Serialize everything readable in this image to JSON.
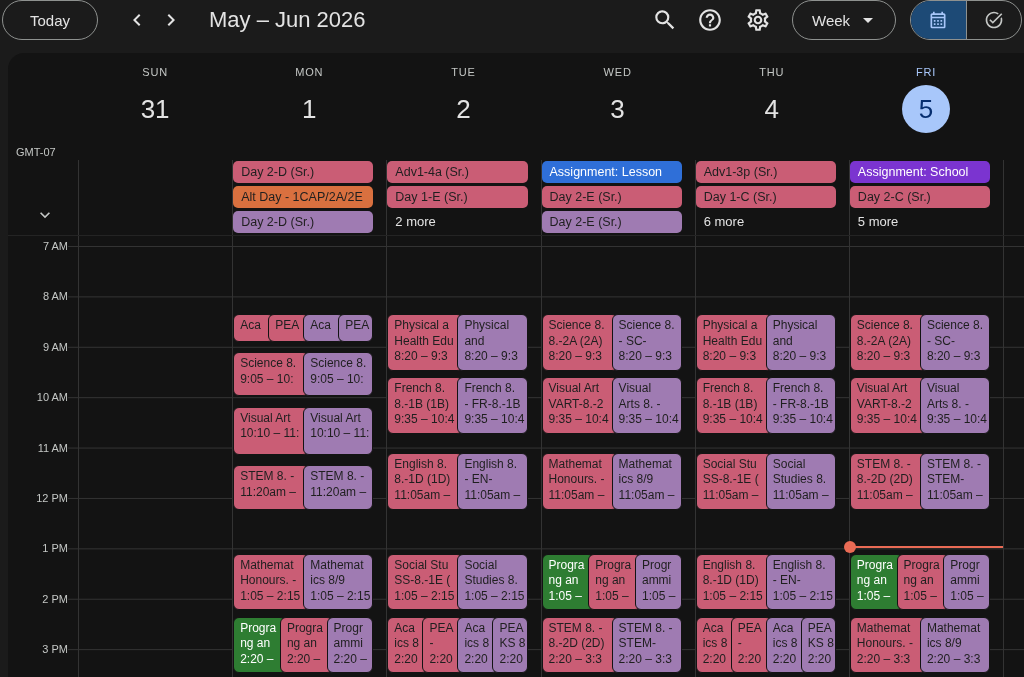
{
  "toolbar": {
    "today_button": "Today",
    "title": "May – Jun 2026",
    "view_dropdown": "Week",
    "view_switch": [
      {
        "kind": "calendar",
        "selected": true
      },
      {
        "kind": "tasks",
        "selected": false
      }
    ]
  },
  "timezone": "GMT-07",
  "days": [
    {
      "name": "SUN",
      "date": "31",
      "today": false
    },
    {
      "name": "MON",
      "date": "1",
      "today": false,
      "all_day": [
        {
          "title": "Day 2-D (Sr.)",
          "color": "#ca5d75"
        },
        {
          "title": "Alt Day - 1CAP/2A/2E",
          "color": "#d9703f"
        },
        {
          "title": "Day 2-D (Sr.)",
          "color": "#9f7bb2"
        }
      ],
      "event_groups": [
        {
          "events": [
            {
              "title": "Aca",
              "color": "#ca5d75"
            },
            {
              "title": "PEA",
              "color": "#ca5d75"
            },
            {
              "title": "Aca",
              "color": "#9f7bb2"
            },
            {
              "title": "PEA",
              "color": "#9f7bb2"
            }
          ]
        },
        {
          "events": [
            {
              "title": "Science 8.",
              "time": "9:05 – 10:",
              "color": "#ca5d75"
            },
            {
              "title": "Science 8.",
              "time": "9:05 – 10:",
              "color": "#9f7bb2"
            }
          ]
        },
        {
          "events": [
            {
              "title": "Visual Art",
              "time": "10:10 – 11:",
              "color": "#ca5d75"
            },
            {
              "title": "Visual Art",
              "time": "10:10 – 11:",
              "color": "#9f7bb2"
            }
          ]
        },
        {
          "events": [
            {
              "title": "STEM 8. -",
              "time": "11:20am –",
              "color": "#ca5d75"
            },
            {
              "title": "STEM 8. -",
              "time": "11:20am –",
              "color": "#9f7bb2"
            }
          ]
        },
        {
          "events": [
            {
              "title": "Mathemat\nHonours. -",
              "time": "1:05 – 2:15",
              "color": "#ca5d75"
            },
            {
              "title": "Mathemat\nics 8/9",
              "time": "1:05 – 2:15",
              "color": "#9f7bb2"
            }
          ]
        },
        {
          "events": [
            {
              "title": "Progra\nng an",
              "time": "2:20 –",
              "color": "#2e7d32"
            },
            {
              "title": "Progra\nng an",
              "time": "2:20 –",
              "color": "#ca5d75"
            },
            {
              "title": "Progr\nammi",
              "time": "2:20 –",
              "color": "#9f7bb2"
            }
          ]
        }
      ]
    },
    {
      "name": "TUE",
      "date": "2",
      "today": false,
      "all_day": [
        {
          "title": "Adv1-4a (Sr.)",
          "color": "#ca5d75"
        },
        {
          "title": "Day 1-E (Sr.)",
          "color": "#ca5d75"
        }
      ],
      "more": "2 more",
      "event_groups": [
        {
          "events": [
            {
              "title": "Physical a\nHealth Edu",
              "time": "8:20 – 9:3",
              "color": "#ca5d75"
            },
            {
              "title": "Physical\nand",
              "time": "8:20 – 9:3",
              "color": "#9f7bb2"
            }
          ]
        },
        {
          "events": [
            {
              "title": "French 8.\n8.-1B (1B)",
              "time": "9:35 – 10:4",
              "color": "#ca5d75"
            },
            {
              "title": "French 8.\n- FR-8.-1B",
              "time": "9:35 – 10:4",
              "color": "#9f7bb2"
            }
          ]
        },
        {
          "events": [
            {
              "title": "English 8.\n8.-1D (1D)",
              "time": "11:05am –",
              "color": "#ca5d75"
            },
            {
              "title": "English 8.\n- EN-",
              "time": "11:05am –",
              "color": "#9f7bb2"
            }
          ]
        },
        {
          "events": [
            {
              "title": "Social Stu\nSS-8.-1E (",
              "time": "1:05 – 2:15",
              "color": "#ca5d75"
            },
            {
              "title": "Social\nStudies 8.",
              "time": "1:05 – 2:15",
              "color": "#9f7bb2"
            }
          ]
        },
        {
          "events": [
            {
              "title": "Aca\nics 8",
              "time": "2:20",
              "color": "#ca5d75"
            },
            {
              "title": "PEA\n-",
              "time": "2:20",
              "color": "#ca5d75"
            },
            {
              "title": "Aca\nics 8",
              "time": "2:20",
              "color": "#9f7bb2"
            },
            {
              "title": "PEA\nKS 8",
              "time": "2:20",
              "color": "#9f7bb2"
            }
          ]
        }
      ]
    },
    {
      "name": "WED",
      "date": "3",
      "today": false,
      "all_day": [
        {
          "title": "Assignment: Lesson",
          "color": "#2f6fd8"
        },
        {
          "title": "Day 2-E (Sr.)",
          "color": "#ca5d75"
        },
        {
          "title": "Day 2-E (Sr.)",
          "color": "#9f7bb2"
        }
      ],
      "event_groups": [
        {
          "events": [
            {
              "title": "Science 8.\n8.-2A (2A)",
              "time": "8:20 – 9:3",
              "color": "#ca5d75"
            },
            {
              "title": "Science 8.\n- SC-",
              "time": "8:20 – 9:3",
              "color": "#9f7bb2"
            }
          ]
        },
        {
          "events": [
            {
              "title": "Visual Art\nVART-8.-2",
              "time": "9:35 – 10:4",
              "color": "#ca5d75"
            },
            {
              "title": "Visual\nArts 8. -",
              "time": "9:35 – 10:4",
              "color": "#9f7bb2"
            }
          ]
        },
        {
          "events": [
            {
              "title": "Mathemat\nHonours. -",
              "time": "11:05am –",
              "color": "#ca5d75"
            },
            {
              "title": "Mathemat\nics 8/9",
              "time": "11:05am –",
              "color": "#9f7bb2"
            }
          ]
        },
        {
          "events": [
            {
              "title": "Progra\nng an",
              "time": "1:05 –",
              "color": "#2e7d32"
            },
            {
              "title": "Progra\nng an",
              "time": "1:05 –",
              "color": "#ca5d75"
            },
            {
              "title": "Progr\nammi",
              "time": "1:05 –",
              "color": "#9f7bb2"
            }
          ]
        },
        {
          "events": [
            {
              "title": "STEM 8. -\n8.-2D (2D)",
              "time": "2:20 – 3:3",
              "color": "#ca5d75"
            },
            {
              "title": "STEM 8. -\nSTEM-",
              "time": "2:20 – 3:3",
              "color": "#9f7bb2"
            }
          ]
        }
      ]
    },
    {
      "name": "THU",
      "date": "4",
      "today": false,
      "all_day": [
        {
          "title": "Adv1-3p (Sr.)",
          "color": "#ca5d75"
        },
        {
          "title": "Day 1-C (Sr.)",
          "color": "#ca5d75"
        }
      ],
      "more": "6 more",
      "event_groups": [
        {
          "events": [
            {
              "title": "Physical a\nHealth Edu",
              "time": "8:20 – 9:3",
              "color": "#ca5d75"
            },
            {
              "title": "Physical\nand",
              "time": "8:20 – 9:3",
              "color": "#9f7bb2"
            }
          ]
        },
        {
          "events": [
            {
              "title": "French 8.\n8.-1B (1B)",
              "time": "9:35 – 10:4",
              "color": "#ca5d75"
            },
            {
              "title": "French 8.\n- FR-8.-1B",
              "time": "9:35 – 10:4",
              "color": "#9f7bb2"
            }
          ]
        },
        {
          "events": [
            {
              "title": "Social Stu\nSS-8.-1E (",
              "time": "11:05am –",
              "color": "#ca5d75"
            },
            {
              "title": "Social\nStudies 8.",
              "time": "11:05am –",
              "color": "#9f7bb2"
            }
          ]
        },
        {
          "events": [
            {
              "title": "English 8.\n8.-1D (1D)",
              "time": "1:05 – 2:15",
              "color": "#ca5d75"
            },
            {
              "title": "English 8.\n- EN-",
              "time": "1:05 – 2:15",
              "color": "#9f7bb2"
            }
          ]
        },
        {
          "events": [
            {
              "title": "Aca\nics 8",
              "time": "2:20",
              "color": "#ca5d75"
            },
            {
              "title": "PEA\n-",
              "time": "2:20",
              "color": "#ca5d75"
            },
            {
              "title": "Aca\nics 8",
              "time": "2:20",
              "color": "#9f7bb2"
            },
            {
              "title": "PEA\nKS 8",
              "time": "2:20",
              "color": "#9f7bb2"
            }
          ]
        }
      ]
    },
    {
      "name": "FRI",
      "date": "5",
      "today": true,
      "all_day": [
        {
          "title": "Assignment: School",
          "color": "#7b34d0"
        },
        {
          "title": "Day 2-C (Sr.)",
          "color": "#ca5d75"
        }
      ],
      "more": "5 more",
      "event_groups": [
        {
          "events": [
            {
              "title": "Science 8.\n8.-2A (2A)",
              "time": "8:20 – 9:3",
              "color": "#ca5d75"
            },
            {
              "title": "Science 8.\n- SC-",
              "time": "8:20 – 9:3",
              "color": "#9f7bb2"
            }
          ]
        },
        {
          "events": [
            {
              "title": "Visual Art\nVART-8.-2",
              "time": "9:35 – 10:4",
              "color": "#ca5d75"
            },
            {
              "title": "Visual\nArts 8. -",
              "time": "9:35 – 10:4",
              "color": "#9f7bb2"
            }
          ]
        },
        {
          "events": [
            {
              "title": "STEM 8. -\n8.-2D (2D)",
              "time": "11:05am –",
              "color": "#ca5d75"
            },
            {
              "title": "STEM 8. -\nSTEM-",
              "time": "11:05am –",
              "color": "#9f7bb2"
            }
          ]
        },
        {
          "events": [
            {
              "title": "Progra\nng an",
              "time": "1:05 –",
              "color": "#2e7d32"
            },
            {
              "title": "Progra\nng an",
              "time": "1:05 –",
              "color": "#ca5d75"
            },
            {
              "title": "Progr\nammi",
              "time": "1:05 –",
              "color": "#9f7bb2"
            }
          ]
        },
        {
          "events": [
            {
              "title": "Mathemat\nHonours. -",
              "time": "2:20 – 3:3",
              "color": "#ca5d75"
            },
            {
              "title": "Mathemat\nics 8/9",
              "time": "2:20 – 3:3",
              "color": "#9f7bb2"
            }
          ]
        }
      ]
    }
  ],
  "time_labels": [
    "7 AM",
    "8 AM",
    "9 AM",
    "10 AM",
    "11 AM",
    "12 PM",
    "1 PM",
    "2 PM",
    "3 PM"
  ]
}
